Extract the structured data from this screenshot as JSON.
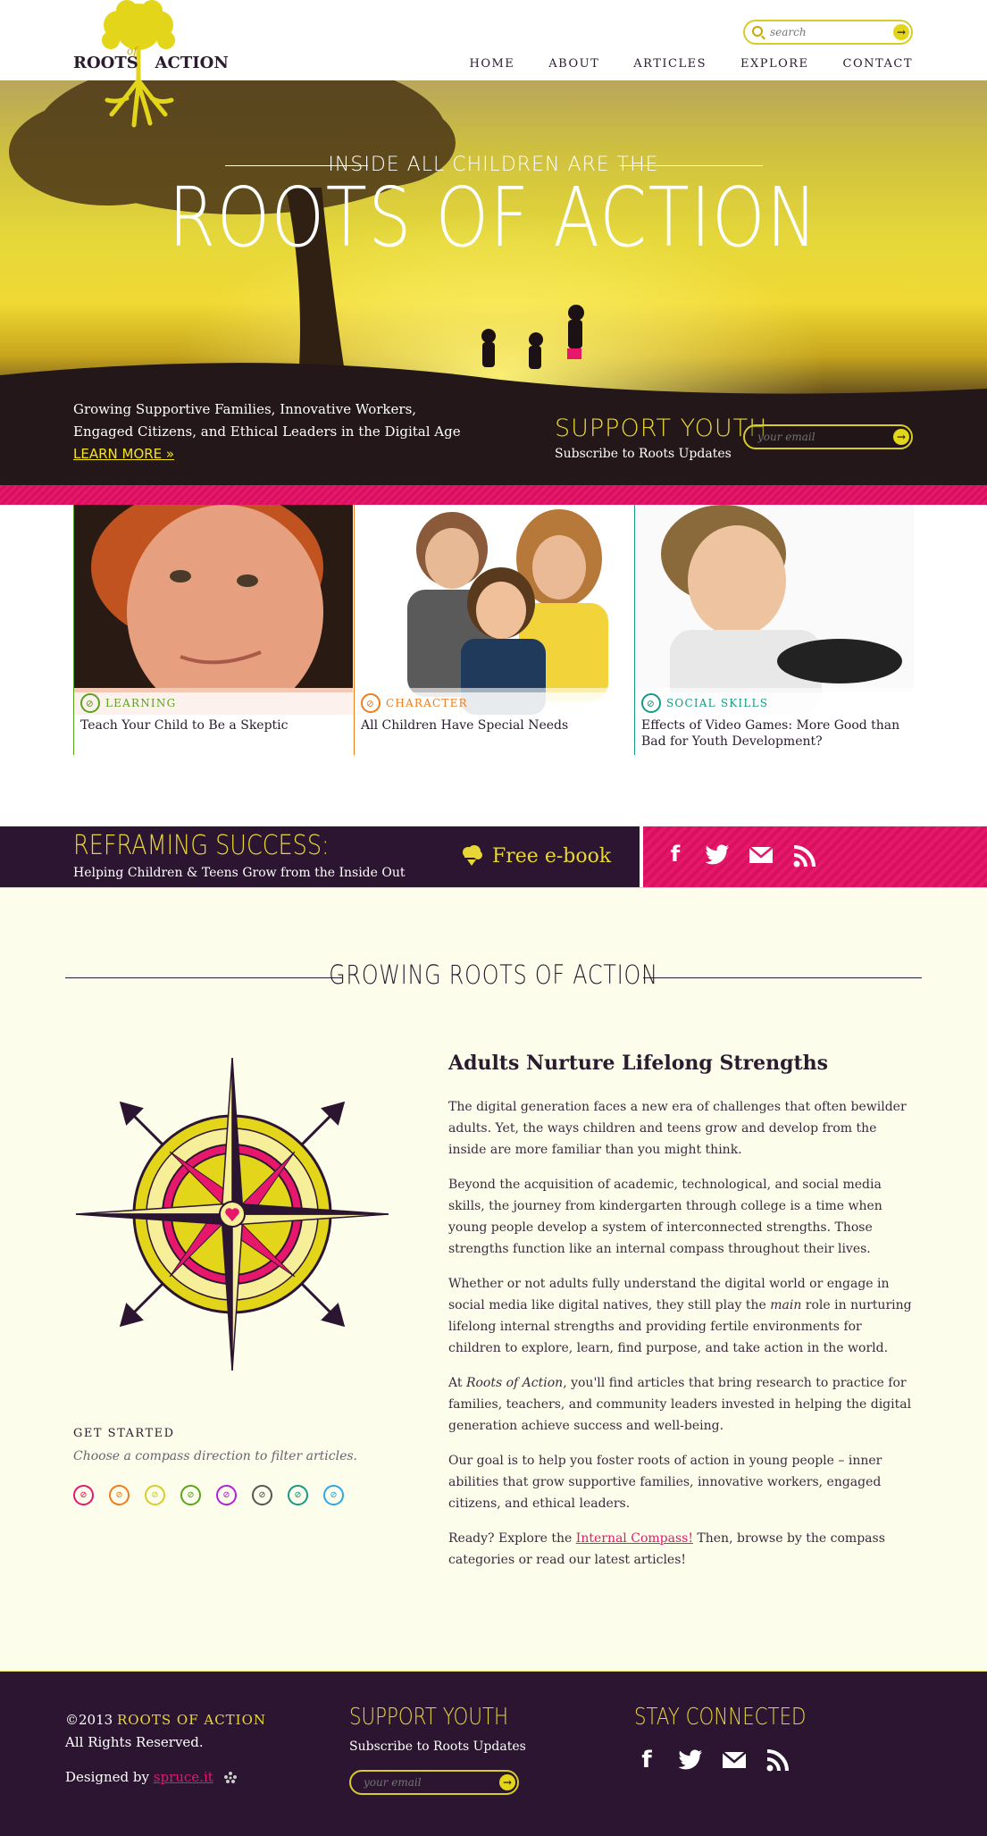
{
  "header": {
    "logo_text": "ROOTS",
    "logo_of": "of",
    "logo_text2": "ACTION",
    "search_placeholder": "search",
    "nav": [
      "HOME",
      "ABOUT",
      "ARTICLES",
      "EXPLORE",
      "CONTACT"
    ]
  },
  "hero": {
    "subtitle": "INSIDE ALL CHILDREN ARE THE",
    "title": "ROOTS OF ACTION",
    "tagline": "Growing Supportive Families, Innovative Workers, Engaged Citizens, and Ethical Leaders in the Digital Age",
    "learn_more": "LEARN MORE »",
    "support_title": "SUPPORT YOUTH",
    "support_sub": "Subscribe to Roots Updates",
    "email_placeholder": "your email"
  },
  "cards": [
    {
      "category": "LEARNING",
      "title": "Teach Your Child to Be a Skeptic",
      "color": "#5aa51c"
    },
    {
      "category": "CHARACTER",
      "title": "All Children Have Special Needs",
      "color": "#f07c1c"
    },
    {
      "category": "SOCIAL SKILLS",
      "title": "Effects of Video Games: More Good than Bad for Youth Development?",
      "color": "#159a84"
    }
  ],
  "promo": {
    "title": "REFRAMING SUCCESS:",
    "subtitle": "Helping Children & Teens Grow from the Inside Out",
    "ebook": "Free e-book"
  },
  "section": {
    "title": "GROWING ROOTS OF ACTION",
    "get_started": "GET STARTED",
    "hint": "Choose a compass direction to filter articles.",
    "direction_colors": [
      "#e7176c",
      "#f07c1c",
      "#d6cc2a",
      "#5aa51c",
      "#b31fe0",
      "#555555",
      "#159a84",
      "#2aa8e8"
    ]
  },
  "article": {
    "heading": "Adults Nurture Lifelong Strengths",
    "p1": "The digital generation faces a new era of challenges that often bewilder adults. Yet, the ways children and teens grow and develop from the inside are more familiar than you might think.",
    "p2": "Beyond the acquisition of academic, technological, and social media skills, the journey from kindergarten through college is a time when young people develop a system of interconnected strengths. Those strengths function like an internal compass throughout their lives.",
    "p3a": "Whether or not adults fully understand the digital world or engage in social media like digital natives, they still play the ",
    "p3em": "main",
    "p3b": " role in nurturing lifelong internal strengths and providing fertile environments for children to explore, learn, find purpose, and take action in the world.",
    "p4a": "At ",
    "p4em": "Roots of Action",
    "p4b": ", you'll find articles that bring research to practice for families, teachers, and community leaders invested in helping the digital generation achieve success and well-being.",
    "p5": "Our goal is to help you foster roots of action in young people – inner abilities that grow supportive families, innovative workers, engaged citizens, and ethical leaders.",
    "p6a": "Ready? Explore the ",
    "p6link": "Internal Compass!",
    "p6b": " Then, browse by the compass categories or read our latest articles!"
  },
  "footer": {
    "copyright": "©2013 ",
    "brand": "ROOTS OF ACTION",
    "rights": "All Rights Reserved.",
    "designed": "Designed by ",
    "designer": "spruce.it",
    "support_title": "SUPPORT YOUTH",
    "support_sub": "Subscribe to Roots Updates",
    "email_placeholder": "your email",
    "connect_title": "STAY CONNECTED"
  }
}
